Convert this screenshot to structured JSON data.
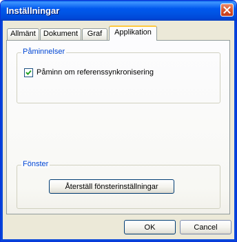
{
  "window": {
    "title": "Inställningar"
  },
  "tabs": [
    {
      "label": "Allmänt"
    },
    {
      "label": "Dokument"
    },
    {
      "label": "Graf"
    },
    {
      "label": "Applikation"
    }
  ],
  "reminders": {
    "legend": "Påminnelser",
    "sync_checkbox_label": "Påminn om referenssynkronisering",
    "sync_checked": true
  },
  "window_group": {
    "legend": "Fönster",
    "reset_button": "Återställ fönsterinställningar"
  },
  "footer": {
    "ok": "OK",
    "cancel": "Cancel"
  },
  "icons": {
    "close": "close-icon",
    "check": "check-icon"
  },
  "colors": {
    "title_bar": "#0058EE",
    "legend_text": "#0046D5",
    "active_tab_highlight": "#FFC83C",
    "dialog_bg": "#ECE9D8"
  }
}
